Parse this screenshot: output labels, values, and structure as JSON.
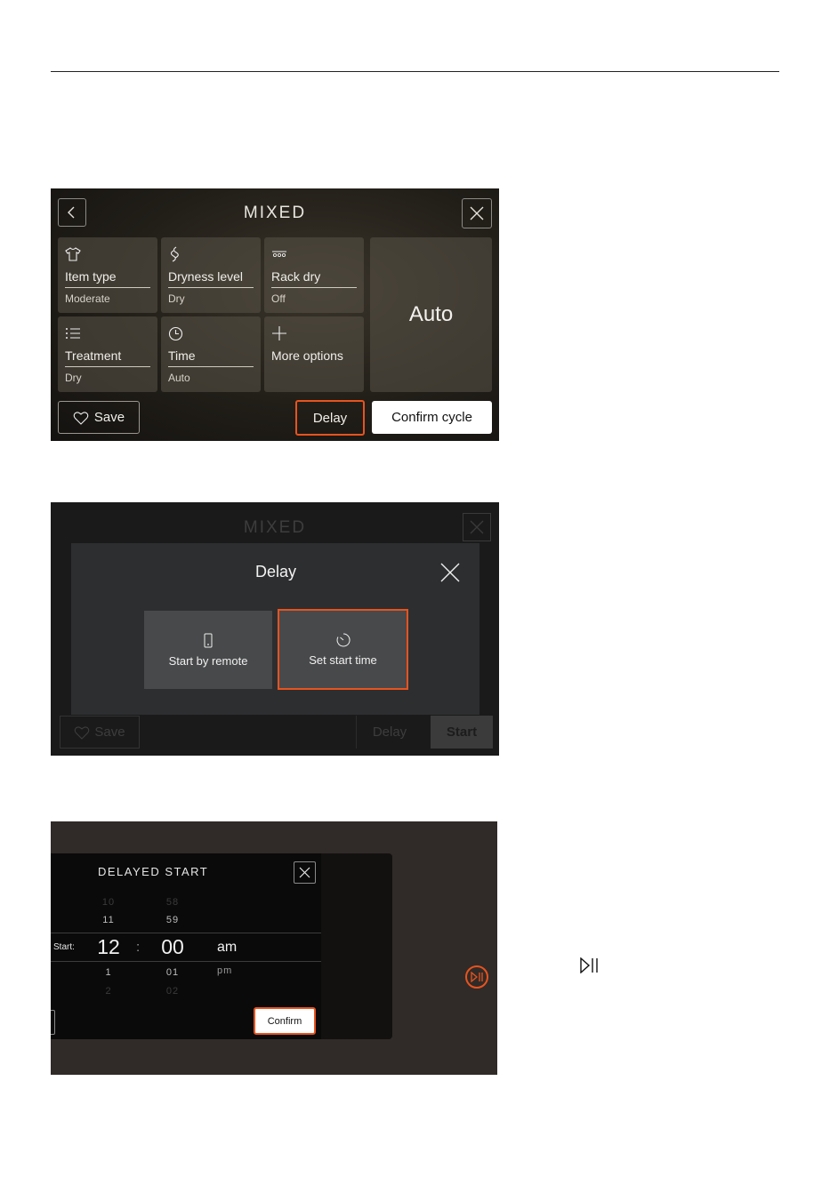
{
  "screen1": {
    "title": "MIXED",
    "tiles": [
      {
        "name": "Item type",
        "value": "Moderate",
        "icon": "shirt-icon"
      },
      {
        "name": "Dryness level",
        "value": "Dry",
        "icon": "dryness-icon"
      },
      {
        "name": "Rack dry",
        "value": "Off",
        "icon": "rack-icon"
      },
      {
        "name": "Treatment",
        "value": "Dry",
        "icon": "list-icon"
      },
      {
        "name": "Time",
        "value": "Auto",
        "icon": "clock-icon"
      },
      {
        "name": "More options",
        "value": "",
        "icon": "plus-icon"
      }
    ],
    "auto_label": "Auto",
    "save_label": "Save",
    "delay_label": "Delay",
    "confirm_label": "Confirm cycle",
    "highlight_color": "#e8531e"
  },
  "screen2": {
    "bg_title": "MIXED",
    "dialog_title": "Delay",
    "options": [
      {
        "label": "Start by remote",
        "icon": "phone-icon"
      },
      {
        "label": "Set start time",
        "icon": "timer-icon"
      }
    ],
    "bg_save_label": "Save",
    "bg_delay_label": "Delay",
    "bg_start_label": "Start"
  },
  "screen3": {
    "title": "DELAYED START",
    "start_label": "Start:",
    "hours": [
      "10",
      "11",
      "12",
      "1",
      "2"
    ],
    "minutes": [
      "58",
      "59",
      "00",
      "01",
      "02"
    ],
    "separator": ":",
    "ampm": [
      "am",
      "pm"
    ],
    "confirm_label": "Confirm"
  }
}
